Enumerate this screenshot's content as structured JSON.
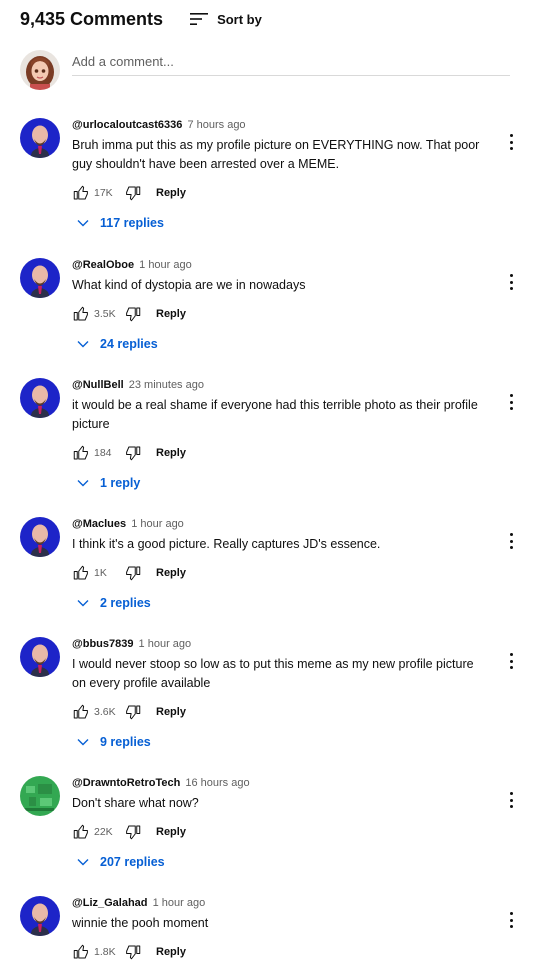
{
  "header": {
    "count": "9,435 Comments",
    "sort_label": "Sort by"
  },
  "add_comment": {
    "placeholder": "Add a comment..."
  },
  "comments": [
    {
      "handle": "@urlocaloutcast6336",
      "time": "7 hours ago",
      "text": "Bruh imma put this as my profile picture on EVERYTHING now. That poor guy shouldn't have been arrested over a MEME.",
      "likes": "17K",
      "reply": "Reply",
      "replies": "117 replies"
    },
    {
      "handle": "@RealOboe",
      "time": "1 hour ago",
      "text": "What kind of dystopia are we in nowadays",
      "likes": "3.5K",
      "reply": "Reply",
      "replies": "24 replies"
    },
    {
      "handle": "@NullBell",
      "time": "23 minutes ago",
      "text": "it would be a real shame if everyone had this terrible photo as their profile picture",
      "likes": "184",
      "reply": "Reply",
      "replies": "1 reply"
    },
    {
      "handle": "@Maclues",
      "time": "1 hour ago",
      "text": "I think it's a good picture. Really captures JD's essence.",
      "likes": "1K",
      "reply": "Reply",
      "replies": "2 replies"
    },
    {
      "handle": "@bbus7839",
      "time": "1 hour ago",
      "text": "I would never stoop so low as to put this meme as my new profile picture on every profile available",
      "likes": "3.6K",
      "reply": "Reply",
      "replies": "9 replies"
    },
    {
      "handle": "@DrawntoRetroTech",
      "time": "16 hours ago",
      "text": "Don't share what now?",
      "likes": "22K",
      "reply": "Reply",
      "replies": "207 replies"
    },
    {
      "handle": "@Liz_Galahad",
      "time": "1 hour ago",
      "text": "winnie the pooh moment",
      "likes": "1.8K",
      "reply": "Reply",
      "replies": ""
    }
  ],
  "colors": {
    "link": "#065fd4",
    "muted": "#606060",
    "text": "#0f0f0f"
  }
}
